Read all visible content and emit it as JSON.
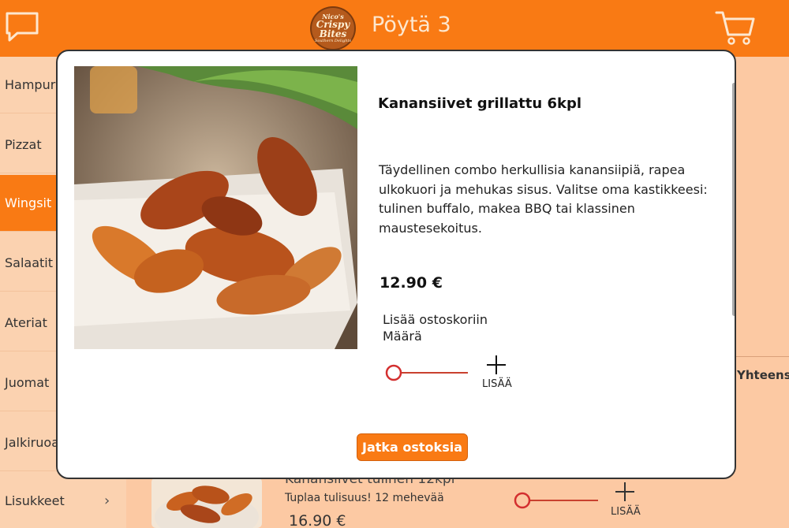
{
  "header": {
    "table_title": "Pöytä 3",
    "logo_line1": "Nico's",
    "logo_line2": "Crispy",
    "logo_line3": "Bites",
    "logo_line4": "Southern Delights",
    "icons": [
      "chat-icon",
      "cart-icon"
    ],
    "bg_color": "#f97a14"
  },
  "sidebar": {
    "items": [
      {
        "label": "Hampurilaiset",
        "active": false
      },
      {
        "label": "Pizzat",
        "active": false
      },
      {
        "label": "Wingsit",
        "active": true
      },
      {
        "label": "Salaatit",
        "active": false
      },
      {
        "label": "Ateriat",
        "active": false
      },
      {
        "label": "Juomat",
        "active": false
      },
      {
        "label": "Jalkiruoat",
        "active": false
      },
      {
        "label": "Lisukkeet",
        "active": false
      }
    ]
  },
  "background": {
    "total_label": "Yhteensä",
    "item_name": "Kanansiivet tulinen 12kpl",
    "item_desc": "Tuplaa tulisuus! 12 mehevää",
    "item_price": "16.90 €",
    "add_label": "LISÄÄ"
  },
  "modal": {
    "name": "Kanansiivet grillattu 6kpl",
    "description": "Täydellinen combo herkullisia kanansiipiä, rapea ulkokuori ja mehukas sisus. Valitse oma kastikkeesi: tulinen buffalo, makea BBQ tai klassinen maustesekoitus.",
    "price": "12.90 €",
    "add_to_cart_label": "Lisää ostoskoriin",
    "quantity_label": "Määrä",
    "quantity_value": 0,
    "add_label": "LISÄÄ",
    "continue_label": "Jatka ostoksia"
  },
  "colors": {
    "accent": "#f97a14",
    "background": "#fcc9a3",
    "slider": "#d32f2f"
  }
}
